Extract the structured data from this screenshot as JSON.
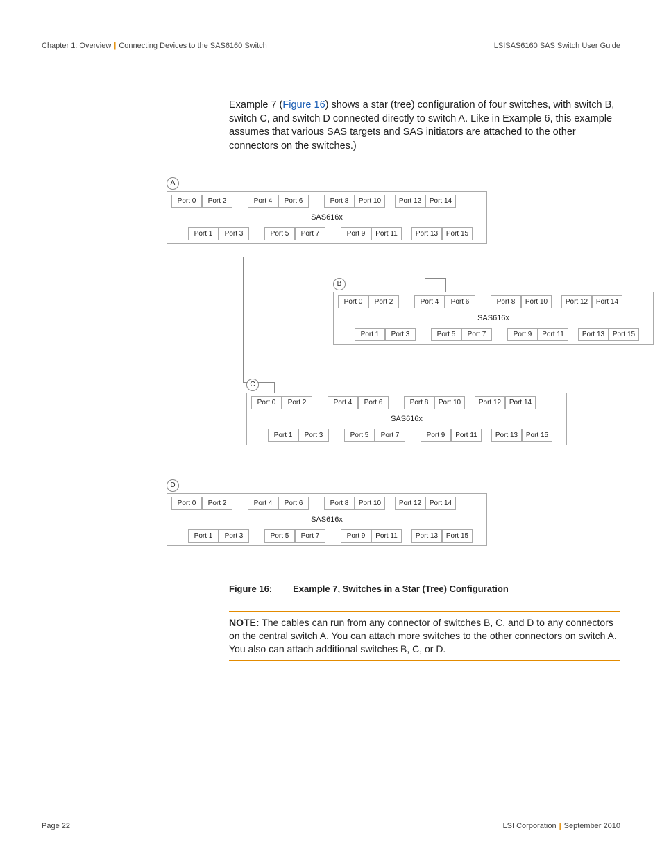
{
  "header": {
    "chapter": "Chapter 1: Overview",
    "section": "Connecting Devices to the SAS6160 Switch",
    "guide": "LSISAS6160 SAS Switch User Guide"
  },
  "body": {
    "pre": "Example 7 (",
    "link": "Figure 16",
    "post": ") shows a star (tree) configuration of four switches, with switch B, switch C, and switch D connected directly to switch A. Like in Example 6, this example assumes that various SAS targets and SAS initiators are attached to the other connectors on the switches.)"
  },
  "switch_model": "SAS616x",
  "switches": {
    "A": {
      "label": "A"
    },
    "B": {
      "label": "B"
    },
    "C": {
      "label": "C"
    },
    "D": {
      "label": "D"
    }
  },
  "ports_top": [
    "Port 0",
    "Port 2",
    "Port 4",
    "Port 6",
    "Port 8",
    "Port 10",
    "Port 12",
    "Port 14"
  ],
  "ports_bottom": [
    "Port 1",
    "Port 3",
    "Port 5",
    "Port 7",
    "Port 9",
    "Port 11",
    "Port 13",
    "Port 15"
  ],
  "caption": {
    "num": "Figure 16:",
    "text": "Example 7, Switches in a Star (Tree) Configuration"
  },
  "note": {
    "label": "NOTE:",
    "text": "The cables can run from any connector of switches B, C, and D to any connectors on the central switch A. You can attach more switches to the other connectors on switch A. You also can attach additional switches B, C, or D."
  },
  "footer": {
    "page": "Page 22",
    "corp": "LSI Corporation",
    "date": "September 2010"
  }
}
